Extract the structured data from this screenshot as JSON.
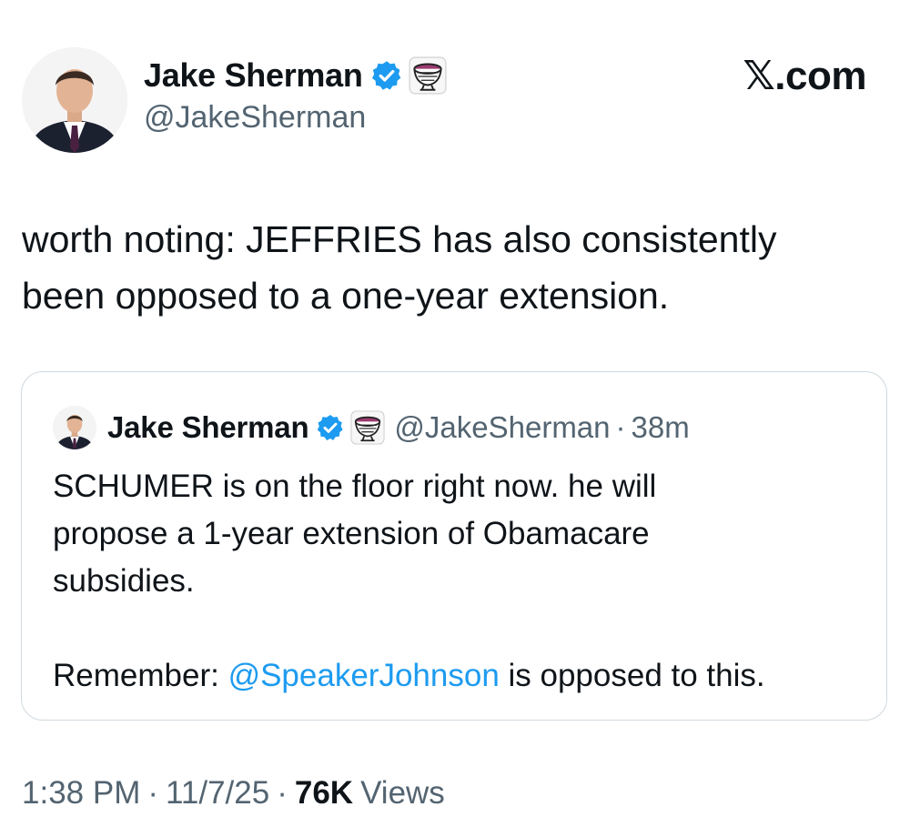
{
  "author": {
    "name": "Jake Sherman",
    "handle": "@JakeSherman"
  },
  "site_label": ".com",
  "tweet": {
    "text_line1": "worth noting: JEFFRIES has also consistently",
    "text_line2": "been opposed to a one-year extension."
  },
  "quoted_tweet": {
    "name": "Jake Sherman",
    "handle": "@JakeSherman",
    "separator": "·",
    "time": "38m",
    "line1": "SCHUMER is on the floor right now. he will",
    "line2": "propose a 1-year extension of Obamacare",
    "line3": "subsidies.",
    "remember_prefix": "Remember: ",
    "mention": "@SpeakerJohnson",
    "remember_suffix": " is opposed to this."
  },
  "footer": {
    "time": "1:38 PM",
    "sep1": "·",
    "date": "11/7/25",
    "sep2": "·",
    "views_count": "76K",
    "views_label": "Views"
  },
  "icons": {
    "verified": "verified-badge-icon",
    "emoji": "pot-emoji-icon",
    "x_logo": "x-logo-icon"
  },
  "colors": {
    "verified_blue": "#1d9bf0",
    "text_primary": "#0f1419",
    "text_secondary": "#536471",
    "card_border": "#cfd9de"
  }
}
